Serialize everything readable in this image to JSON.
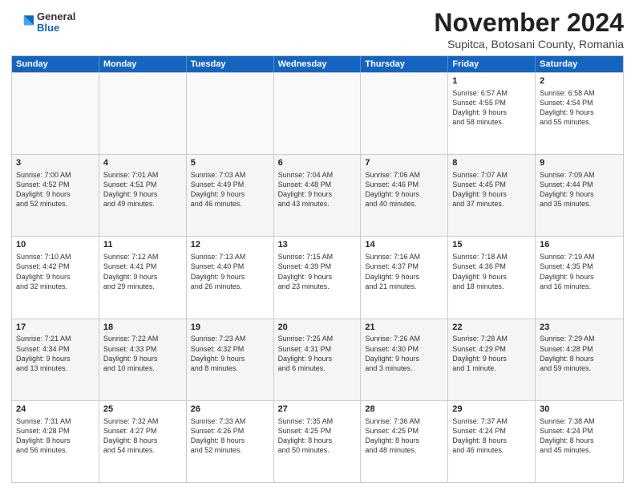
{
  "header": {
    "logo_general": "General",
    "logo_blue": "Blue",
    "month_title": "November 2024",
    "subtitle": "Supitca, Botosani County, Romania"
  },
  "weekdays": [
    "Sunday",
    "Monday",
    "Tuesday",
    "Wednesday",
    "Thursday",
    "Friday",
    "Saturday"
  ],
  "rows": [
    [
      {
        "day": "",
        "empty": true
      },
      {
        "day": "",
        "empty": true
      },
      {
        "day": "",
        "empty": true
      },
      {
        "day": "",
        "empty": true
      },
      {
        "day": "",
        "empty": true
      },
      {
        "day": "1",
        "lines": [
          "Sunrise: 6:57 AM",
          "Sunset: 4:55 PM",
          "Daylight: 9 hours",
          "and 58 minutes."
        ]
      },
      {
        "day": "2",
        "lines": [
          "Sunrise: 6:58 AM",
          "Sunset: 4:54 PM",
          "Daylight: 9 hours",
          "and 55 minutes."
        ]
      }
    ],
    [
      {
        "day": "3",
        "lines": [
          "Sunrise: 7:00 AM",
          "Sunset: 4:52 PM",
          "Daylight: 9 hours",
          "and 52 minutes."
        ]
      },
      {
        "day": "4",
        "lines": [
          "Sunrise: 7:01 AM",
          "Sunset: 4:51 PM",
          "Daylight: 9 hours",
          "and 49 minutes."
        ]
      },
      {
        "day": "5",
        "lines": [
          "Sunrise: 7:03 AM",
          "Sunset: 4:49 PM",
          "Daylight: 9 hours",
          "and 46 minutes."
        ]
      },
      {
        "day": "6",
        "lines": [
          "Sunrise: 7:04 AM",
          "Sunset: 4:48 PM",
          "Daylight: 9 hours",
          "and 43 minutes."
        ]
      },
      {
        "day": "7",
        "lines": [
          "Sunrise: 7:06 AM",
          "Sunset: 4:46 PM",
          "Daylight: 9 hours",
          "and 40 minutes."
        ]
      },
      {
        "day": "8",
        "lines": [
          "Sunrise: 7:07 AM",
          "Sunset: 4:45 PM",
          "Daylight: 9 hours",
          "and 37 minutes."
        ]
      },
      {
        "day": "9",
        "lines": [
          "Sunrise: 7:09 AM",
          "Sunset: 4:44 PM",
          "Daylight: 9 hours",
          "and 35 minutes."
        ]
      }
    ],
    [
      {
        "day": "10",
        "lines": [
          "Sunrise: 7:10 AM",
          "Sunset: 4:42 PM",
          "Daylight: 9 hours",
          "and 32 minutes."
        ]
      },
      {
        "day": "11",
        "lines": [
          "Sunrise: 7:12 AM",
          "Sunset: 4:41 PM",
          "Daylight: 9 hours",
          "and 29 minutes."
        ]
      },
      {
        "day": "12",
        "lines": [
          "Sunrise: 7:13 AM",
          "Sunset: 4:40 PM",
          "Daylight: 9 hours",
          "and 26 minutes."
        ]
      },
      {
        "day": "13",
        "lines": [
          "Sunrise: 7:15 AM",
          "Sunset: 4:39 PM",
          "Daylight: 9 hours",
          "and 23 minutes."
        ]
      },
      {
        "day": "14",
        "lines": [
          "Sunrise: 7:16 AM",
          "Sunset: 4:37 PM",
          "Daylight: 9 hours",
          "and 21 minutes."
        ]
      },
      {
        "day": "15",
        "lines": [
          "Sunrise: 7:18 AM",
          "Sunset: 4:36 PM",
          "Daylight: 9 hours",
          "and 18 minutes."
        ]
      },
      {
        "day": "16",
        "lines": [
          "Sunrise: 7:19 AM",
          "Sunset: 4:35 PM",
          "Daylight: 9 hours",
          "and 16 minutes."
        ]
      }
    ],
    [
      {
        "day": "17",
        "lines": [
          "Sunrise: 7:21 AM",
          "Sunset: 4:34 PM",
          "Daylight: 9 hours",
          "and 13 minutes."
        ]
      },
      {
        "day": "18",
        "lines": [
          "Sunrise: 7:22 AM",
          "Sunset: 4:33 PM",
          "Daylight: 9 hours",
          "and 10 minutes."
        ]
      },
      {
        "day": "19",
        "lines": [
          "Sunrise: 7:23 AM",
          "Sunset: 4:32 PM",
          "Daylight: 9 hours",
          "and 8 minutes."
        ]
      },
      {
        "day": "20",
        "lines": [
          "Sunrise: 7:25 AM",
          "Sunset: 4:31 PM",
          "Daylight: 9 hours",
          "and 6 minutes."
        ]
      },
      {
        "day": "21",
        "lines": [
          "Sunrise: 7:26 AM",
          "Sunset: 4:30 PM",
          "Daylight: 9 hours",
          "and 3 minutes."
        ]
      },
      {
        "day": "22",
        "lines": [
          "Sunrise: 7:28 AM",
          "Sunset: 4:29 PM",
          "Daylight: 9 hours",
          "and 1 minute."
        ]
      },
      {
        "day": "23",
        "lines": [
          "Sunrise: 7:29 AM",
          "Sunset: 4:28 PM",
          "Daylight: 8 hours",
          "and 59 minutes."
        ]
      }
    ],
    [
      {
        "day": "24",
        "lines": [
          "Sunrise: 7:31 AM",
          "Sunset: 4:28 PM",
          "Daylight: 8 hours",
          "and 56 minutes."
        ]
      },
      {
        "day": "25",
        "lines": [
          "Sunrise: 7:32 AM",
          "Sunset: 4:27 PM",
          "Daylight: 8 hours",
          "and 54 minutes."
        ]
      },
      {
        "day": "26",
        "lines": [
          "Sunrise: 7:33 AM",
          "Sunset: 4:26 PM",
          "Daylight: 8 hours",
          "and 52 minutes."
        ]
      },
      {
        "day": "27",
        "lines": [
          "Sunrise: 7:35 AM",
          "Sunset: 4:25 PM",
          "Daylight: 8 hours",
          "and 50 minutes."
        ]
      },
      {
        "day": "28",
        "lines": [
          "Sunrise: 7:36 AM",
          "Sunset: 4:25 PM",
          "Daylight: 8 hours",
          "and 48 minutes."
        ]
      },
      {
        "day": "29",
        "lines": [
          "Sunrise: 7:37 AM",
          "Sunset: 4:24 PM",
          "Daylight: 8 hours",
          "and 46 minutes."
        ]
      },
      {
        "day": "30",
        "lines": [
          "Sunrise: 7:38 AM",
          "Sunset: 4:24 PM",
          "Daylight: 8 hours",
          "and 45 minutes."
        ]
      }
    ]
  ]
}
